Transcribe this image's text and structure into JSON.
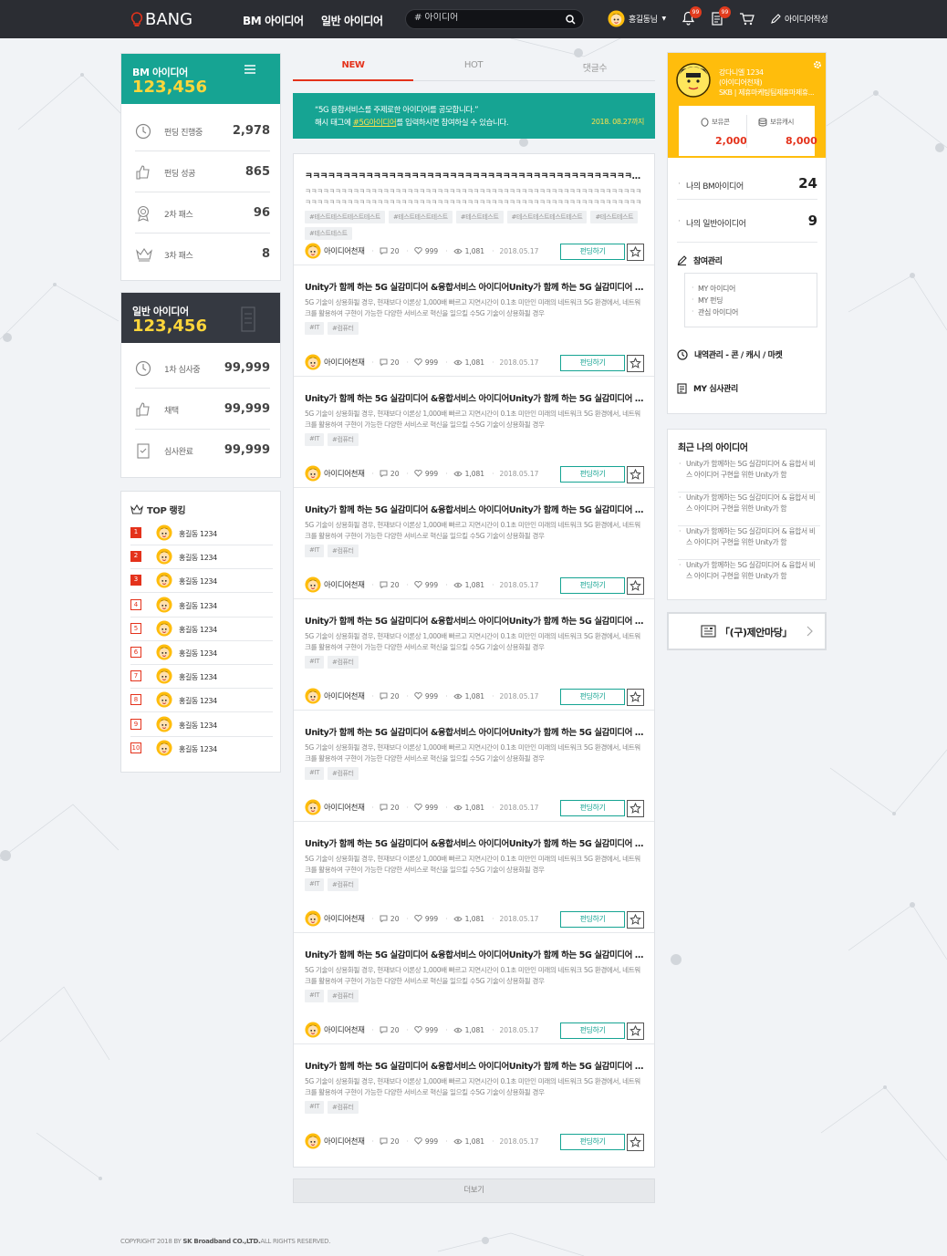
{
  "header": {
    "logo": "BANG",
    "nav": [
      "BM 아이디어",
      "일반 아이디어"
    ],
    "search_placeholder": "# 아이디어",
    "user_name": "홍길동님",
    "notif_badge": "99",
    "msg_badge": "99",
    "write_label": "아이디어작성"
  },
  "bm_card": {
    "title": "BM 아이디어",
    "total": "123,456",
    "rows": [
      {
        "label": "펀딩 진행중",
        "value": "2,978"
      },
      {
        "label": "펀딩 성공",
        "value": "865"
      },
      {
        "label": "2차 패스",
        "value": "96"
      },
      {
        "label": "3차 패스",
        "value": "8"
      }
    ]
  },
  "general_card": {
    "title": "일반 아이디어",
    "total": "123,456",
    "rows": [
      {
        "label": "1차 심사중",
        "value": "99,999"
      },
      {
        "label": "채택",
        "value": "99,999"
      },
      {
        "label": "심사완료",
        "value": "99,999"
      }
    ]
  },
  "ranking": {
    "title": "TOP 랭킹",
    "items": [
      {
        "rank": "1",
        "name": "홍길동 1234"
      },
      {
        "rank": "2",
        "name": "홍길동 1234"
      },
      {
        "rank": "3",
        "name": "홍길동 1234"
      },
      {
        "rank": "4",
        "name": "홍길동 1234"
      },
      {
        "rank": "5",
        "name": "홍길동 1234"
      },
      {
        "rank": "6",
        "name": "홍길동 1234"
      },
      {
        "rank": "7",
        "name": "홍길동 1234"
      },
      {
        "rank": "8",
        "name": "홍길동 1234"
      },
      {
        "rank": "9",
        "name": "홍길동 1234"
      },
      {
        "rank": "10",
        "name": "홍길동 1234"
      }
    ]
  },
  "tabs": [
    "NEW",
    "HOT",
    "댓글수"
  ],
  "banner": {
    "line1": "“5G 융합서비스를 주제로한 아이디어를 공모합니다.”",
    "line2_pre": "해시 태그에 ",
    "line2_hl": "#5G아이디어",
    "line2_post": "를 입력하시면 참여하실 수 있습니다.",
    "date": "2018. 08.27까지"
  },
  "first_post": {
    "title": "ㅋㅋㅋㅋㅋㅋㅋㅋㅋㅋㅋㅋㅋㅋㅋㅋㅋㅋㅋㅋㅋㅋㅋㅋㅋㅋㅋㅋㅋㅋㅋㅋㅋㅋㅋㅋㅋㅋㅋㅋㅋㅋㅋㅋㅋㅋㅋㅋㅋㅋㅋㅋㅋㅋㅋㅋㅋㅋㅋㅋㅋㅋㅋㅋㅋㅋㅋㅋㅋㅋㅋㅋ...",
    "body": "ㅋㅋㅋㅋㅋㅋㅋㅋㅋㅋㅋㅋㅋㅋㅋㅋㅋㅋㅋㅋㅋㅋㅋㅋㅋㅋㅋㅋㅋㅋㅋㅋㅋㅋㅋㅋㅋㅋㅋㅋㅋㅋㅋㅋㅋㅋㅋㅋㅋㅋㅋㅋㅋㅋㅋㅋㅋㅋㅋㅋㅋㅋㅋㅋㅋㅋㅋㅋㅋㅋㅋㅋㅋㅋㅋㅋㅋㅋㅋㅋㅋㅋㅋㅋㅋㅋㅋㅋㅋㅋㅋㅋㅋㅋㅋㅋㅋㅋㅋㅋㅋㅋㅋㅋㅋㅋㅋㅋㅋㅋㅋㅋㅋㅋㅋㅋㅋㅋㅋㅋ",
    "tags": [
      "#테스트테스트테스트테스트",
      "#테스트테스트테스트",
      "#테스트테스트",
      "#테스트테스트테스트테스트",
      "#테스트테스트",
      "#테스트테스트"
    ]
  },
  "post": {
    "title": "Unity가 함께 하는 5G 실감미디어 &융합서비스 아이디어Unity가 함께 하는 5G 실감미디어 &융합서비스 아이디어",
    "body": "5G 기술이 상용화될 경우, 현재보다 이론상 1,000배 빠르고 지연시간이 0.1초 미만인 미래의 네트워크 5G 환경에서, 네트워크를 활용하여 구현이 가능한 다양한 서비스로 혁신을 일으킬 수5G 기술이 상용화될 경우",
    "tags": [
      "#IT",
      "#컴퓨터"
    ]
  },
  "post_meta": {
    "author": "아이디어천재",
    "comments": "20",
    "likes": "999",
    "views": "1,081",
    "date": "2018.05.17",
    "fund_label": "펀딩하기"
  },
  "post_count_repeat": 8,
  "more_label": "더보기",
  "footer": {
    "pre": "COPYRIGHT 2018 BY ",
    "company": "SK Broadband CO.,LTD.",
    "post": "ALL RIGHTS RESERVED."
  },
  "profile": {
    "name": "강다니엘 1234",
    "nickname": "(아이디어천재)",
    "team": "SKB | 제휴마케팅팀제휴마제휴...",
    "coin_label": "보유콘",
    "coin_value": "2,000",
    "cash_label": "보유캐시",
    "cash_value": "8,000",
    "bm_ideas_label": "나의 BM아이디어",
    "bm_ideas_value": "24",
    "general_ideas_label": "나의 일반아이디어",
    "general_ideas_value": "9",
    "participation_label": "참여관리",
    "participation_items": [
      "MY 아이디어",
      "MY 펀딩",
      "관심 아이디어"
    ],
    "history_label": "내역관리 - 콘 / 캐시 / 마켓",
    "review_label": "MY 심사관리"
  },
  "recent": {
    "title": "최근 나의 아이디어",
    "items": [
      "Unity가 함께하는 5G 실감미디어 & 융합서 비스 아이디어 구현을 위한 Unity가 함",
      "Unity가 함께하는 5G 실감미디어 & 융합서 비스 아이디어 구현을 위한 Unity가 함",
      "Unity가 함께하는 5G 실감미디어 & 융합서 비스 아이디어 구현을 위한 Unity가 함",
      "Unity가 함께하는 5G 실감미디어 & 융합서 비스 아이디어 구현을 위한 Unity가 함"
    ]
  },
  "legacy_label": "「(구)제안마당」",
  "colors": {
    "accent_red": "#e4321b",
    "teal": "#16a493",
    "yellow": "#ffbd0c",
    "dark": "#2b2d33"
  },
  "icons": [
    "bulb-icon",
    "search-icon",
    "bell-icon",
    "document-icon",
    "cart-icon",
    "pencil-icon",
    "clock-icon",
    "thumbs-up-icon",
    "medal-icon",
    "crown-icon",
    "checklist-icon",
    "star-icon",
    "comment-icon",
    "heart-icon",
    "eye-icon",
    "gear-icon",
    "coin-icon",
    "chevron-right-icon"
  ]
}
